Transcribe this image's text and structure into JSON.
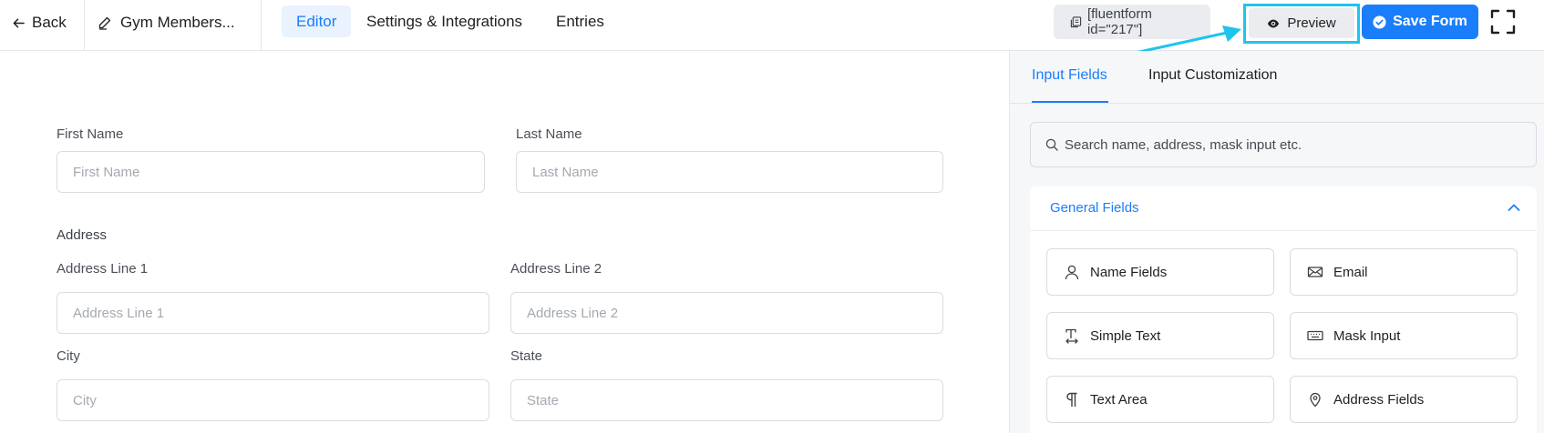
{
  "header": {
    "back_label": "Back",
    "form_name": "Gym Members...",
    "tabs": [
      "Editor",
      "Settings & Integrations",
      "Entries"
    ],
    "active_tab": "Editor",
    "shortcode": "[fluentform id=\"217\"]",
    "preview_label": "Preview",
    "save_label": "Save Form"
  },
  "form": {
    "first_name": {
      "label": "First Name",
      "placeholder": "First Name"
    },
    "last_name": {
      "label": "Last Name",
      "placeholder": "Last Name"
    },
    "address_section": "Address",
    "address_line1": {
      "label": "Address Line 1",
      "placeholder": "Address Line 1"
    },
    "address_line2": {
      "label": "Address Line 2",
      "placeholder": "Address Line 2"
    },
    "city": {
      "label": "City",
      "placeholder": "City"
    },
    "state": {
      "label": "State",
      "placeholder": "State"
    }
  },
  "sidebar": {
    "tabs": [
      "Input Fields",
      "Input Customization"
    ],
    "active_tab": "Input Fields",
    "search_placeholder": "Search name, address, mask input etc.",
    "general_fields_title": "General Fields",
    "fields": [
      {
        "label": "Name Fields",
        "icon": "user-icon"
      },
      {
        "label": "Email",
        "icon": "envelope-icon"
      },
      {
        "label": "Simple Text",
        "icon": "text-cursor-icon"
      },
      {
        "label": "Mask Input",
        "icon": "keyboard-icon"
      },
      {
        "label": "Text Area",
        "icon": "paragraph-icon"
      },
      {
        "label": "Address Fields",
        "icon": "map-pin-icon"
      }
    ]
  },
  "colors": {
    "accent": "#1a7efb",
    "highlight": "#1ec4ec"
  }
}
